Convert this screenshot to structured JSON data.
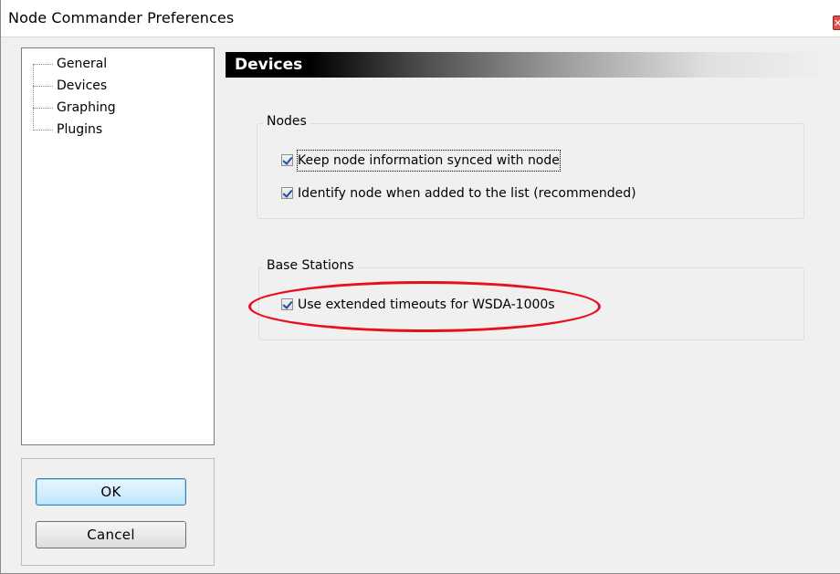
{
  "window": {
    "title": "Node Commander Preferences",
    "close_glyph": "✕"
  },
  "tree": {
    "items": [
      {
        "label": "General"
      },
      {
        "label": "Devices"
      },
      {
        "label": "Graphing"
      },
      {
        "label": "Plugins"
      }
    ]
  },
  "buttons": {
    "ok_label": "OK",
    "cancel_label": "Cancel"
  },
  "section": {
    "title": "Devices"
  },
  "nodes_group": {
    "label": "Nodes",
    "options": [
      {
        "label": "Keep node information synced with node",
        "checked": true
      },
      {
        "label": "Identify node when added to the list (recommended)",
        "checked": true
      }
    ]
  },
  "base_stations_group": {
    "label": "Base Stations",
    "options": [
      {
        "label": "Use extended timeouts for WSDA-1000s",
        "checked": true
      }
    ]
  },
  "annotation": {
    "color": "#e8101c"
  },
  "colors": {
    "header_bg": "#000000",
    "window_bg": "#f0f0f0",
    "checkmark": "#1f4f9a"
  }
}
